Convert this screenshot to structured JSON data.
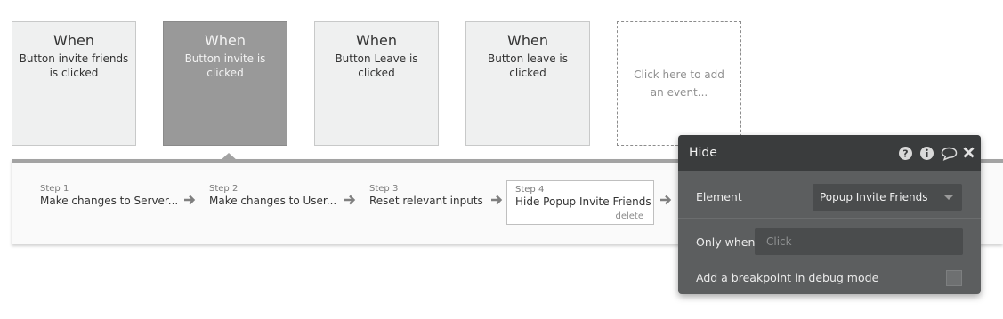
{
  "events": [
    {
      "when": "When",
      "desc": "Button invite friends is clicked",
      "active": false
    },
    {
      "when": "When",
      "desc": "Button invite is clicked",
      "active": true
    },
    {
      "when": "When",
      "desc": "Button Leave is clicked",
      "active": false
    },
    {
      "when": "When",
      "desc": "Button leave is clicked",
      "active": false
    }
  ],
  "add_event": {
    "label": "Click here to add an event..."
  },
  "steps": [
    {
      "label": "Step 1",
      "title": "Make changes to Server..."
    },
    {
      "label": "Step 2",
      "title": "Make changes to User..."
    },
    {
      "label": "Step 3",
      "title": "Reset relevant inputs"
    },
    {
      "label": "Step 4",
      "title": "Hide Popup Invite Friends",
      "delete_label": "delete"
    }
  ],
  "panel": {
    "title": "Hide",
    "icons": [
      "help-icon",
      "info-icon",
      "comment-icon",
      "close-icon"
    ],
    "element_label": "Element",
    "element_value": "Popup Invite Friends",
    "only_when_label": "Only when",
    "only_when_placeholder": "Click",
    "breakpoint_label": "Add a breakpoint in debug mode"
  },
  "colors": {
    "card_bg": "#eff0f0",
    "card_active_bg": "#999999",
    "panel_bg": "#5c5e5f",
    "panel_header_bg": "#3a3c3d"
  }
}
